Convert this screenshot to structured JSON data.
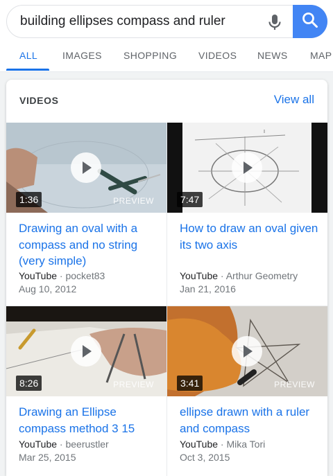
{
  "search": {
    "query": "building ellipses compass and ruler"
  },
  "tabs": [
    {
      "label": "ALL",
      "active": true
    },
    {
      "label": "IMAGES"
    },
    {
      "label": "SHOPPING"
    },
    {
      "label": "VIDEOS"
    },
    {
      "label": "NEWS"
    },
    {
      "label": "MAP"
    }
  ],
  "colors": {
    "accent": "#1a73e8",
    "search_button": "#4285f4"
  },
  "videos_card": {
    "title": "VIDEOS",
    "view_all": "View all",
    "items": [
      {
        "title": "Drawing an oval with a compass and no string (very simple)",
        "duration": "1:36",
        "preview": "PREVIEW",
        "source": "YouTube",
        "separator": "·",
        "channel": "pocket83",
        "date": "Aug 10, 2012"
      },
      {
        "title": "How to draw an oval given its two axis",
        "duration": "7:47",
        "preview": "",
        "source": "YouTube",
        "separator": "·",
        "channel": "Arthur Geometry",
        "date": "Jan 21, 2016"
      },
      {
        "title": "Drawing an Ellipse compass method 3 15",
        "duration": "8:26",
        "preview": "PREVIEW",
        "source": "YouTube",
        "separator": "·",
        "channel": "beerustler",
        "date": "Mar 25, 2015"
      },
      {
        "title": "ellipse drawn with a ruler and compass",
        "duration": "3:41",
        "preview": "PREVIEW",
        "source": "YouTube",
        "separator": "·",
        "channel": "Mika Tori",
        "date": "Oct 3, 2015"
      }
    ]
  }
}
